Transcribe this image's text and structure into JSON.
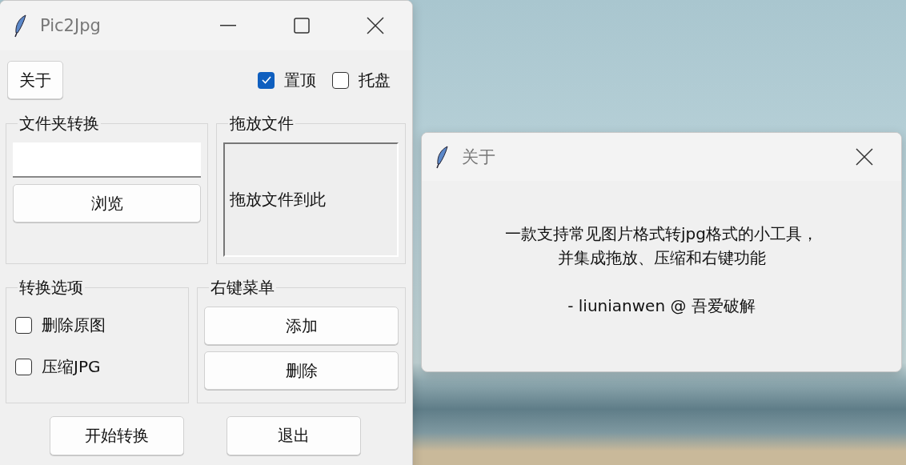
{
  "main_window": {
    "title": "Pic2Jpg",
    "about_button": "关于",
    "top_options": [
      {
        "label": "置顶",
        "checked": true
      },
      {
        "label": "托盘",
        "checked": false
      }
    ],
    "folder_group": {
      "title": "文件夹转换",
      "browse_button": "浏览"
    },
    "drop_group": {
      "title": "拖放文件",
      "hint": "拖放文件到此"
    },
    "convert_group": {
      "title": "转换选项",
      "options": [
        {
          "label": "删除原图",
          "checked": false
        },
        {
          "label": "压缩JPG",
          "checked": false
        }
      ]
    },
    "context_menu_group": {
      "title": "右键菜单",
      "buttons": [
        "添加",
        "删除"
      ]
    },
    "buttons": [
      "开始转换",
      "退出"
    ]
  },
  "about_dialog": {
    "title": "关于",
    "message_lines": [
      "一款支持常见图片格式转jpg格式的小工具，",
      "并集成拖放、压缩和右键功能"
    ],
    "credit": "- liunianwen @ 吾爱破解"
  }
}
